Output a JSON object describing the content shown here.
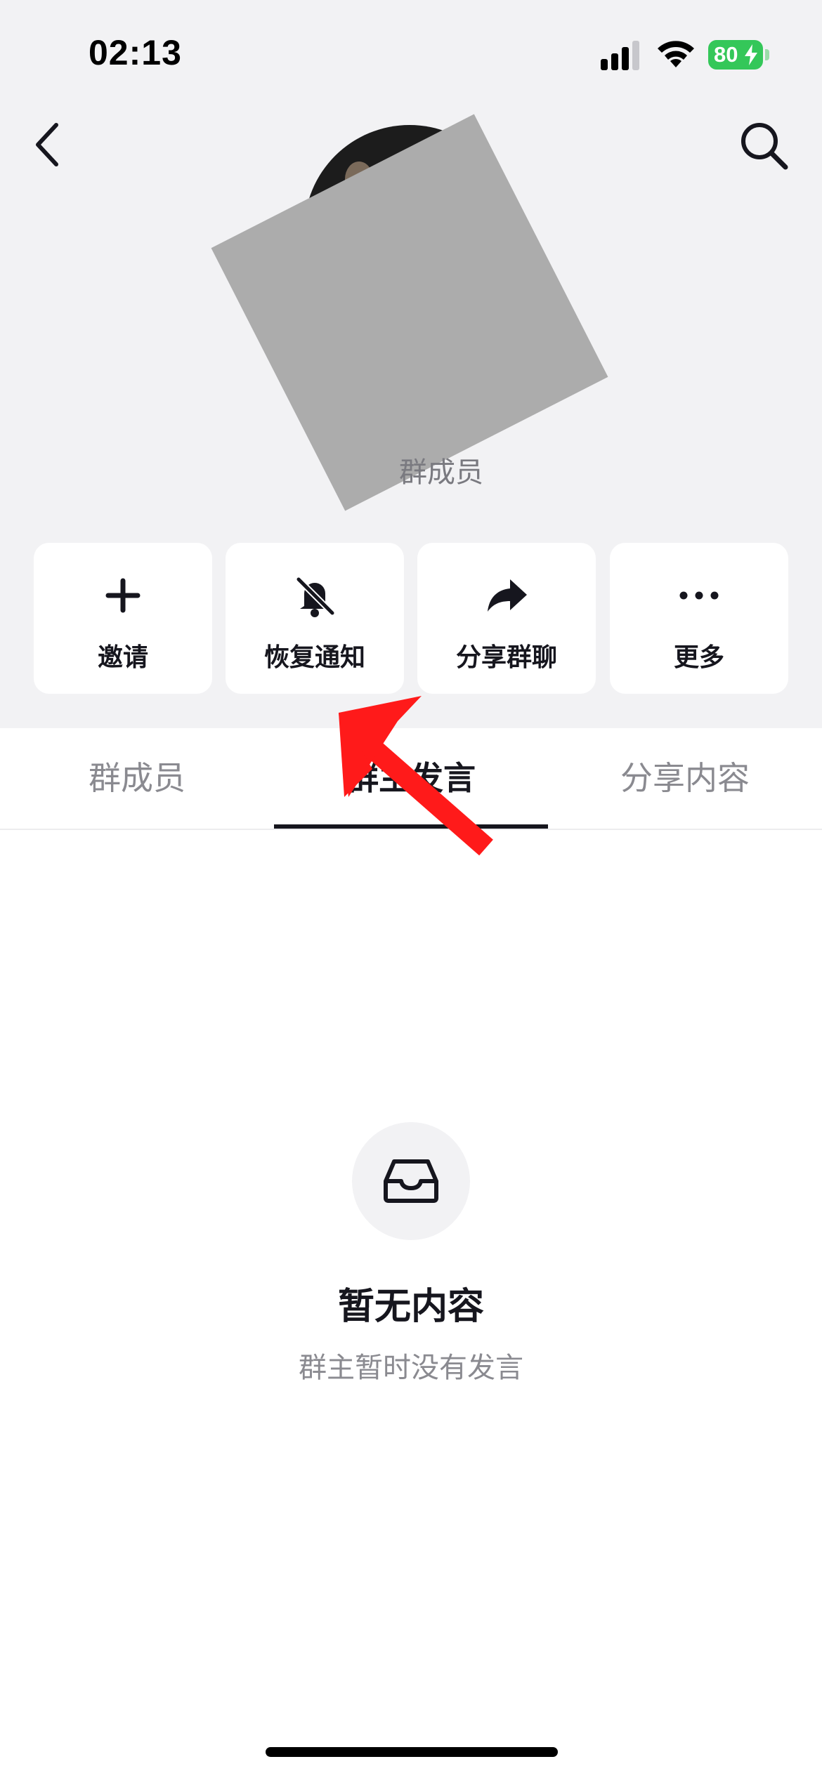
{
  "status_bar": {
    "time": "02:13",
    "battery_level": "80",
    "icons": [
      "signal-icon",
      "wifi-icon",
      "battery-icon",
      "charging-bolt-icon"
    ]
  },
  "nav": {
    "back_icon": "chevron-left-icon",
    "search_icon": "search-icon"
  },
  "group": {
    "members_label": "群成员"
  },
  "actions": [
    {
      "label": "邀请",
      "icon": "plus-icon"
    },
    {
      "label": "恢复通知",
      "icon": "bell-slash-icon"
    },
    {
      "label": "分享群聊",
      "icon": "share-arrow-icon"
    },
    {
      "label": "更多",
      "icon": "more-dots-icon"
    }
  ],
  "tabs": [
    {
      "label": "群成员",
      "active": false
    },
    {
      "label": "群主发言",
      "active": true
    },
    {
      "label": "分享内容",
      "active": false
    }
  ],
  "empty_state": {
    "icon": "inbox-tray-icon",
    "title": "暂无内容",
    "subtitle": "群主暂时没有发言"
  },
  "colors": {
    "header_background": "#f2f2f4",
    "battery": "#34c759",
    "annotation_arrow": "#ff1a1a",
    "redaction": "#acacac"
  }
}
